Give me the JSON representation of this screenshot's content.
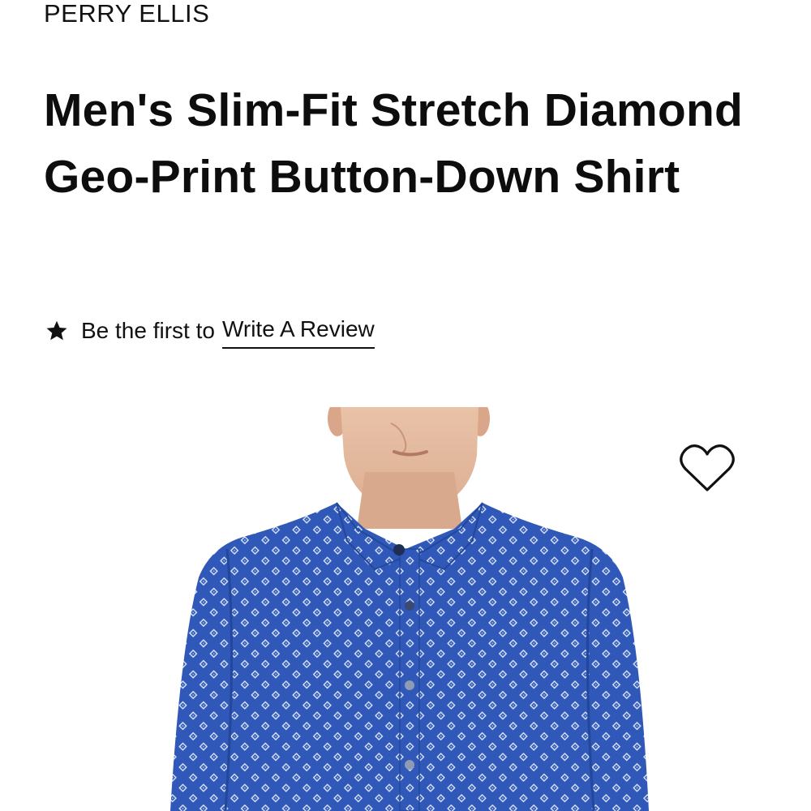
{
  "product": {
    "brand": "PERRY ELLIS",
    "title": "Men's Slim-Fit Stretch Diamond Geo-Print Button-Down Shirt"
  },
  "reviews": {
    "star_icon": "star-icon",
    "prefix": "Be the first to",
    "link_label": "Write A Review"
  },
  "image": {
    "shirt_color": "#2f58b8",
    "pattern_color": "#e8eefc"
  },
  "wishlist": {
    "icon": "heart-outline-icon"
  }
}
